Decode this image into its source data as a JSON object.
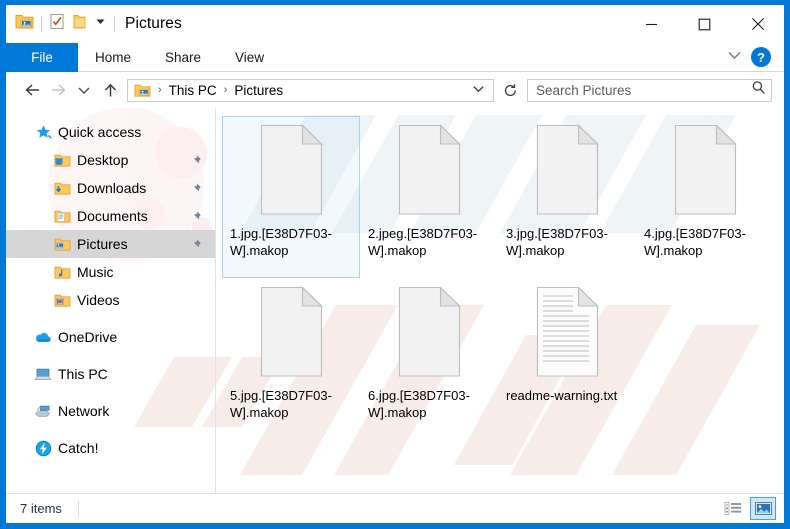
{
  "window": {
    "title": "Pictures",
    "accent_color": "#0078d7",
    "quick_access_toolbar": [
      {
        "name": "pictures-folder-icon",
        "label": "Pictures folder"
      },
      {
        "name": "properties-icon",
        "label": "Properties"
      },
      {
        "name": "new-folder-icon",
        "label": "New folder"
      },
      {
        "name": "customize-quick-access-chevron-icon",
        "label": "Customize Quick Access Toolbar"
      }
    ],
    "controls": {
      "minimize": "Minimize",
      "maximize": "Maximize",
      "close": "Close"
    }
  },
  "ribbon": {
    "tabs": [
      {
        "label": "File",
        "active": true
      },
      {
        "label": "Home",
        "active": false
      },
      {
        "label": "Share",
        "active": false
      },
      {
        "label": "View",
        "active": false
      }
    ],
    "expand_ribbon": "Expand the Ribbon",
    "help": "?"
  },
  "address": {
    "back": "Back",
    "forward": "Forward",
    "recent": "Recent locations",
    "up": "Up",
    "breadcrumbs": [
      "This PC",
      "Pictures"
    ],
    "separator": "›",
    "refresh": "Refresh"
  },
  "search": {
    "placeholder": "Search Pictures",
    "value": ""
  },
  "sidebar": {
    "items": [
      {
        "label": "Quick access",
        "icon": "star-icon",
        "level": 0,
        "pinned": false,
        "selected": false
      },
      {
        "label": "Desktop",
        "icon": "desktop-folder-icon",
        "level": 1,
        "pinned": true,
        "selected": false
      },
      {
        "label": "Downloads",
        "icon": "downloads-folder-icon",
        "level": 1,
        "pinned": true,
        "selected": false
      },
      {
        "label": "Documents",
        "icon": "documents-folder-icon",
        "level": 1,
        "pinned": true,
        "selected": false
      },
      {
        "label": "Pictures",
        "icon": "pictures-folder-icon",
        "level": 1,
        "pinned": true,
        "selected": true
      },
      {
        "label": "Music",
        "icon": "music-folder-icon",
        "level": 1,
        "pinned": false,
        "selected": false
      },
      {
        "label": "Videos",
        "icon": "videos-folder-icon",
        "level": 1,
        "pinned": false,
        "selected": false
      },
      {
        "label": "OneDrive",
        "icon": "onedrive-icon",
        "level": 0,
        "pinned": false,
        "selected": false
      },
      {
        "label": "This PC",
        "icon": "this-pc-icon",
        "level": 0,
        "pinned": false,
        "selected": false
      },
      {
        "label": "Network",
        "icon": "network-icon",
        "level": 0,
        "pinned": false,
        "selected": false
      },
      {
        "label": "Catch!",
        "icon": "catch-icon",
        "level": 0,
        "pinned": false,
        "selected": false
      }
    ]
  },
  "files": [
    {
      "name": "1.jpg.[E38D7F03-W].makop",
      "icon": "blank-file-icon",
      "selected": true
    },
    {
      "name": "2.jpeg.[E38D7F03-W].makop",
      "icon": "blank-file-icon",
      "selected": false
    },
    {
      "name": "3.jpg.[E38D7F03-W].makop",
      "icon": "blank-file-icon",
      "selected": false
    },
    {
      "name": "4.jpg.[E38D7F03-W].makop",
      "icon": "blank-file-icon",
      "selected": false
    },
    {
      "name": "5.jpg.[E38D7F03-W].makop",
      "icon": "blank-file-icon",
      "selected": false
    },
    {
      "name": "6.jpg.[E38D7F03-W].makop",
      "icon": "blank-file-icon",
      "selected": false
    },
    {
      "name": "readme-warning.txt",
      "icon": "text-file-icon",
      "selected": false
    }
  ],
  "status": {
    "item_count": "7 items",
    "views": [
      {
        "name": "details-view-button",
        "label": "Details view",
        "active": false
      },
      {
        "name": "large-icons-view-button",
        "label": "Large icons view",
        "active": true
      }
    ]
  }
}
